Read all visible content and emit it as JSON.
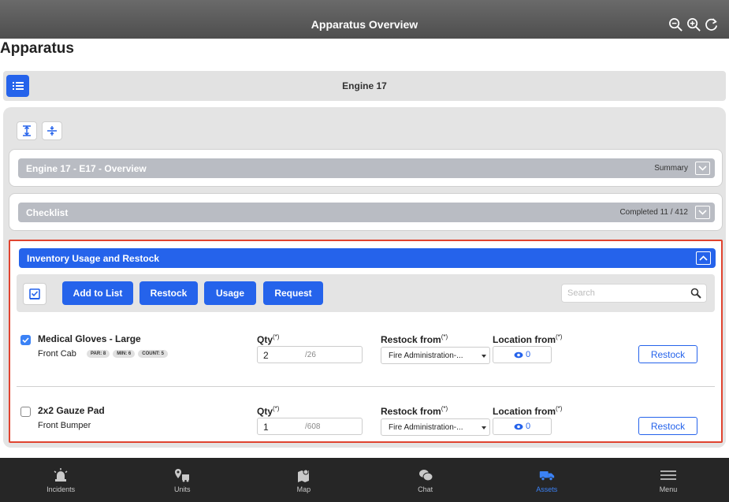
{
  "topbar": {
    "title": "Apparatus Overview",
    "icons": [
      "zoom-out-icon",
      "zoom-in-icon",
      "refresh-icon"
    ]
  },
  "page": {
    "title": "Apparatus"
  },
  "apparatus": {
    "name": "Engine 17"
  },
  "sections": {
    "overview": {
      "label": "Engine 17 - E17 - Overview",
      "meta": "Summary"
    },
    "checklist": {
      "label": "Checklist",
      "meta": "Completed 11 / 412"
    },
    "inventory": {
      "label": "Inventory Usage and Restock"
    }
  },
  "toolbar": {
    "buttons": [
      "Add to List",
      "Restock",
      "Usage",
      "Request"
    ],
    "search_placeholder": "Search"
  },
  "field_labels": {
    "qty": "Qty",
    "restock_from": "Restock from",
    "location_from": "Location from",
    "required": "(*)"
  },
  "items": [
    {
      "name": "Medical Gloves - Large",
      "location": "Front Cab",
      "checked": true,
      "tags": [
        "PAR: 8",
        "MIN: 6",
        "COUNT: 5"
      ],
      "qty": "2",
      "qty_max": "/26",
      "restock_from": "Fire Administration-...",
      "location_count": "0",
      "action": "Restock"
    },
    {
      "name": "2x2 Gauze Pad",
      "location": "Front Bumper",
      "checked": false,
      "tags": [],
      "qty": "1",
      "qty_max": "/608",
      "restock_from": "Fire Administration-...",
      "location_count": "0",
      "action": "Restock"
    }
  ],
  "bottomnav": [
    {
      "label": "Incidents",
      "icon": "siren-icon",
      "active": false
    },
    {
      "label": "Units",
      "icon": "units-icon",
      "active": false
    },
    {
      "label": "Map",
      "icon": "map-icon",
      "active": false
    },
    {
      "label": "Chat",
      "icon": "chat-icon",
      "active": false
    },
    {
      "label": "Assets",
      "icon": "truck-icon",
      "active": true
    },
    {
      "label": "Menu",
      "icon": "hamburger-icon",
      "active": false
    }
  ],
  "colors": {
    "accent": "#2563eb",
    "highlight_border": "#e0432f",
    "nav_bg": "#262626"
  }
}
